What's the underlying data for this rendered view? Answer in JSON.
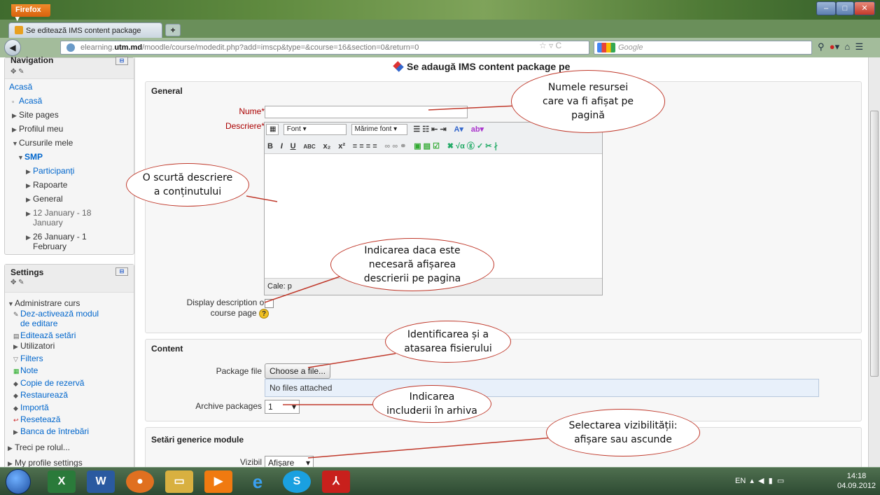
{
  "browser": {
    "menu_label": "Firefox",
    "tab_title": "Se editează IMS content package",
    "url_prefix": "elearning.",
    "url_domain": "utm.md",
    "url_path": "/moodle/course/modedit.php?add=imscp&type=&course=16&section=0&return=0",
    "search_placeholder": "Google"
  },
  "sidebar": {
    "nav_title": "Navigation",
    "nav_items": {
      "home_top": "Acasă",
      "home": "Acasă",
      "site_pages": "Site pages",
      "profile": "Profilul meu",
      "my_courses": "Cursurile mele",
      "smp": "SMP",
      "participants": "Participanți",
      "reports": "Rapoarte",
      "general": "General",
      "week1a": "12 January - 18",
      "week1b": "January",
      "week2a": "26 January - 1",
      "week2b": "February"
    },
    "settings_title": "Settings",
    "settings_items": {
      "course_admin": "Administrare curs",
      "edit_off_a": "Dez-activează modul",
      "edit_off_b": "de editare",
      "edit_settings": "Editează setări",
      "users": "Utilizatori",
      "filters": "Filters",
      "grades": "Note",
      "backup": "Copie de rezervă",
      "restore": "Restaurează",
      "import": "Importă",
      "reset": "Resetează",
      "question_bank": "Banca de întrebări",
      "switch_role": "Treci pe rolul...",
      "my_profile": "My profile settings"
    }
  },
  "main": {
    "page_title": "Se adaugă IMS content package pe",
    "general": {
      "legend": "General",
      "name_label": "Nume",
      "desc_label": "Descriere",
      "required_mark": "*",
      "font_select": "Font",
      "size_select": "Mărime font",
      "path_label": "Cale: p",
      "display_desc_a": "Display description on",
      "display_desc_b": "course page"
    },
    "content": {
      "legend": "Content",
      "package_label": "Package file",
      "choose_button": "Choose a file...",
      "no_files": "No files attached",
      "archive_label": "Archive packages",
      "archive_value": "1"
    },
    "module": {
      "legend": "Setări generice module",
      "visible_label": "Vizibil",
      "visible_value": "Afișare"
    }
  },
  "callouts": {
    "name": "Numele resursei\ncare va fi afișat pe\npagină",
    "desc": "O scurtă descriere\na conținutului",
    "display": "Indicarea daca este\nnecesară afișarea\ndescrierii pe pagina",
    "file": "Identificarea și a\natasarea fisierului",
    "archive": "Indicarea\nincluderii în arhiva",
    "visibility": "Selectarea vizibilității:\nafișare sau ascunde"
  },
  "taskbar": {
    "lang": "EN",
    "time": "14:18",
    "date": "04.09.2012"
  },
  "colors": {
    "link": "#0066cc",
    "required": "#aa0000",
    "callout_border": "#c0392b"
  }
}
